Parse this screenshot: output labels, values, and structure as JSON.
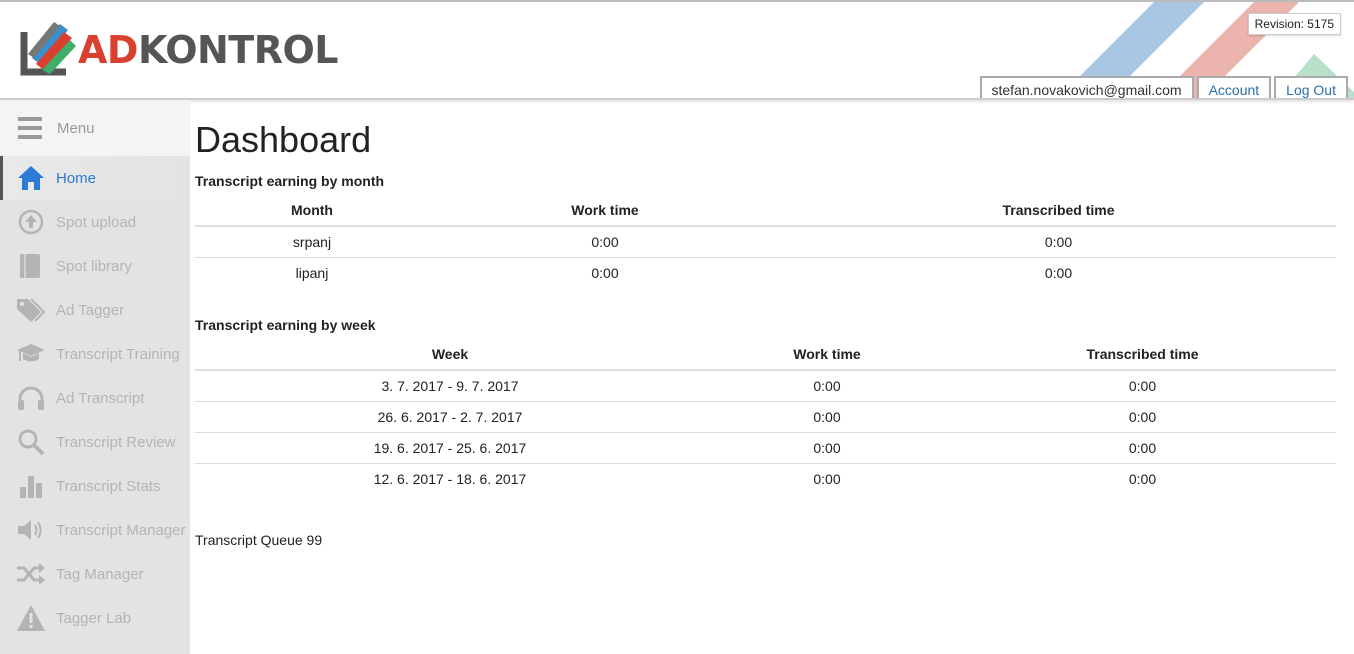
{
  "header": {
    "logo_ad": "AD",
    "logo_kontrol": "KONTROL",
    "revision": "Revision: 5175",
    "user_email": "stefan.novakovich@gmail.com",
    "account_label": "Account",
    "logout_label": "Log Out"
  },
  "sidebar": {
    "menu_label": "Menu",
    "items": [
      {
        "label": "Home",
        "icon": "home-icon"
      },
      {
        "label": "Spot upload",
        "icon": "upload-icon"
      },
      {
        "label": "Spot library",
        "icon": "book-icon"
      },
      {
        "label": "Ad Tagger",
        "icon": "tags-icon"
      },
      {
        "label": "Transcript Training",
        "icon": "graduation-cap-icon"
      },
      {
        "label": "Ad Transcript",
        "icon": "headphones-icon"
      },
      {
        "label": "Transcript Review",
        "icon": "search-icon"
      },
      {
        "label": "Transcript Stats",
        "icon": "bar-chart-icon"
      },
      {
        "label": "Transcript Manager",
        "icon": "volume-icon"
      },
      {
        "label": "Tag Manager",
        "icon": "shuffle-icon"
      },
      {
        "label": "Tagger Lab",
        "icon": "warning-icon"
      }
    ]
  },
  "main": {
    "title": "Dashboard",
    "month_section": {
      "title": "Transcript earning by month",
      "headers": [
        "Month",
        "Work time",
        "Transcribed time"
      ],
      "rows": [
        [
          "srpanj",
          "0:00",
          "0:00"
        ],
        [
          "lipanj",
          "0:00",
          "0:00"
        ]
      ]
    },
    "week_section": {
      "title": "Transcript earning by week",
      "headers": [
        "Week",
        "Work time",
        "Transcribed time"
      ],
      "rows": [
        [
          "3. 7. 2017 - 9. 7. 2017",
          "0:00",
          "0:00"
        ],
        [
          "26. 6. 2017 - 2. 7. 2017",
          "0:00",
          "0:00"
        ],
        [
          "19. 6. 2017 - 25. 6. 2017",
          "0:00",
          "0:00"
        ],
        [
          "12. 6. 2017 - 18. 6. 2017",
          "0:00",
          "0:00"
        ]
      ]
    },
    "queue": "Transcript Queue 99"
  },
  "colors": {
    "accent": "#2c7bd6",
    "logo_red": "#d9412e",
    "logo_gray": "#555555",
    "sidebar_bg": "#e3e3e3"
  }
}
